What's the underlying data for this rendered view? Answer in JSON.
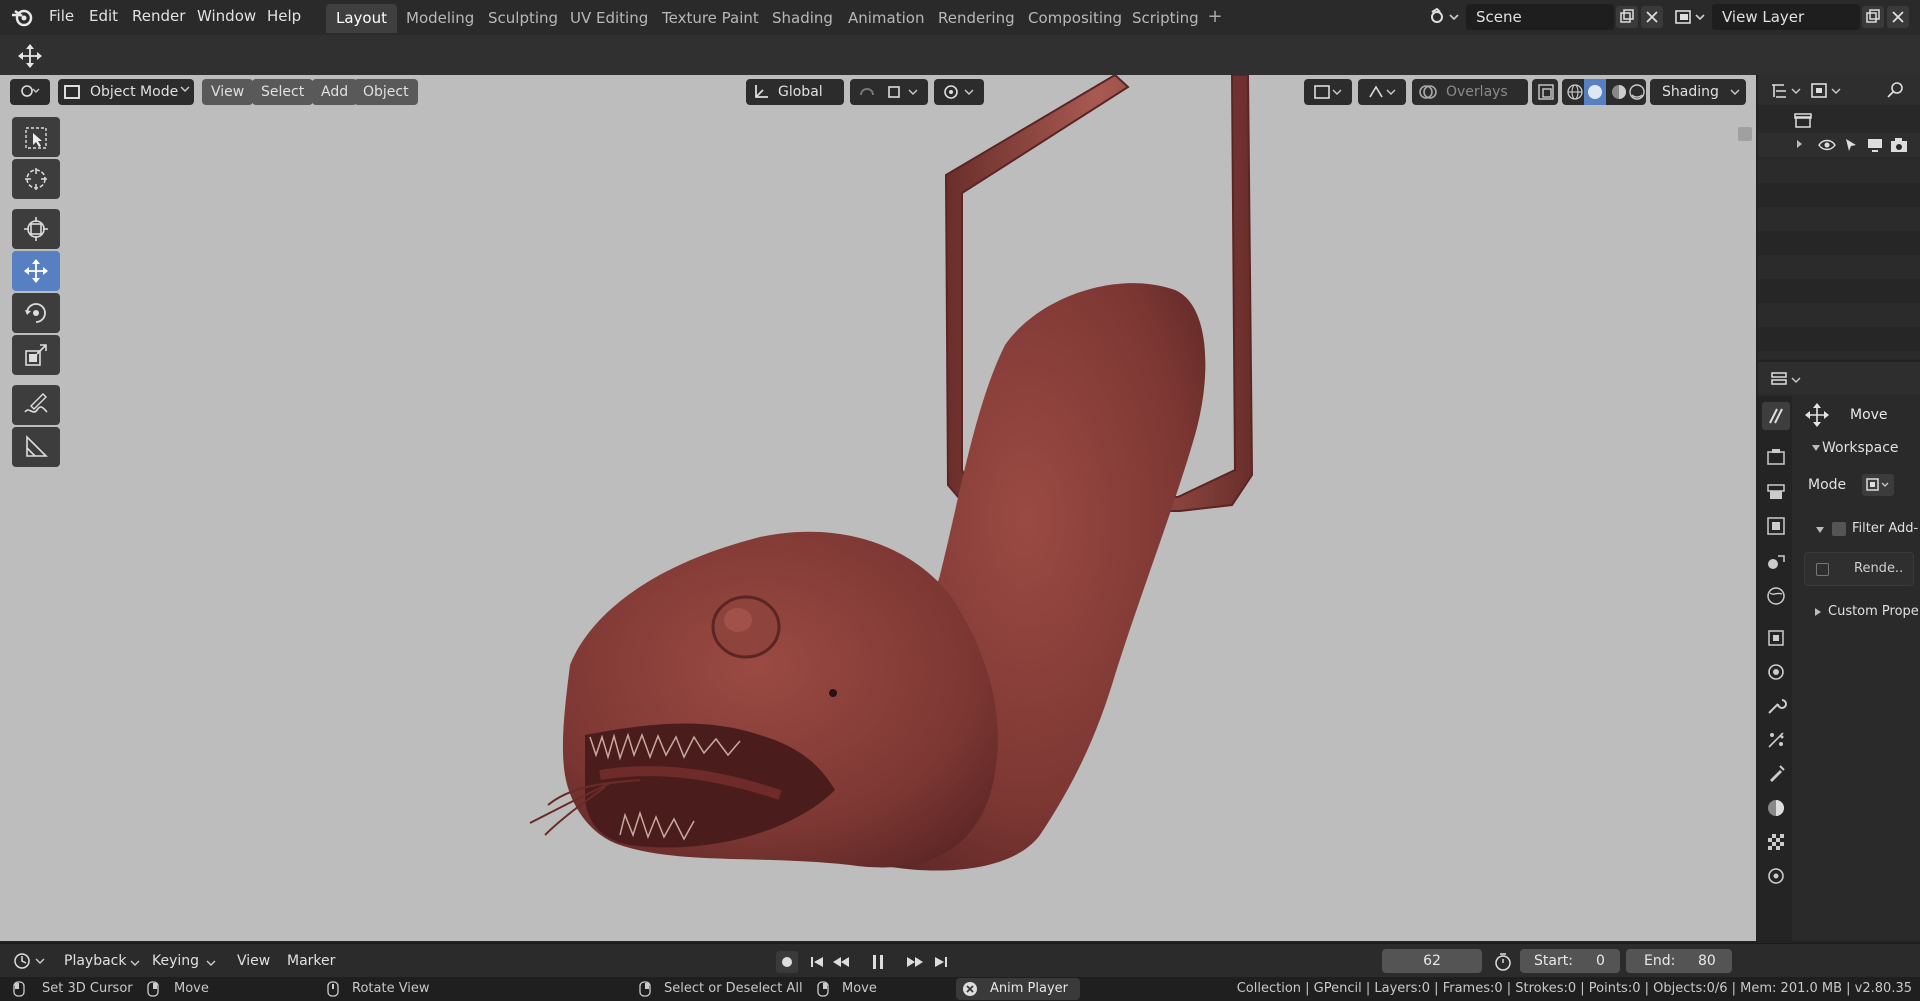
{
  "menu": {
    "items": [
      "File",
      "Edit",
      "Render",
      "Window",
      "Help"
    ]
  },
  "workspaces": {
    "tabs": [
      "Layout",
      "Modeling",
      "Sculpting",
      "UV Editing",
      "Texture Paint",
      "Shading",
      "Animation",
      "Rendering",
      "Compositing",
      "Scripting"
    ],
    "active": "Layout",
    "add_symbol": "+"
  },
  "scene": {
    "name": "Scene"
  },
  "view_layer": {
    "name": "View Layer"
  },
  "viewport_header": {
    "mode": "Object Mode",
    "menus": [
      "View",
      "Select",
      "Add",
      "Object"
    ],
    "orientation": "Global",
    "overlays_label": "Overlays",
    "shading_label": "Shading"
  },
  "tools": [
    "select-box",
    "cursor",
    "move-tool",
    "move",
    "rotate",
    "scale",
    "annotate",
    "measure"
  ],
  "active_tool": "move",
  "properties": {
    "tool_name": "Move",
    "workspace_panel": "Workspace",
    "mode_label": "Mode",
    "filter_addons_label": "Filter Add-",
    "render_label": "Rende..",
    "custom_props_label": "Custom Prope"
  },
  "timeline": {
    "menus": [
      "Playback",
      "Keying",
      "View",
      "Marker"
    ],
    "current_frame": "62",
    "start_label": "Start:",
    "start_value": "0",
    "end_label": "End:",
    "end_value": "80"
  },
  "status": {
    "set_cursor": "Set 3D Cursor",
    "move1": "Move",
    "rotate_view": "Rotate View",
    "select_all": "Select or Deselect All",
    "move2": "Move",
    "anim_player": "Anim Player",
    "stats": "Collection | GPencil | Layers:0 | Frames:0 | Strokes:0 | Points:0 | Objects:0/6 | Mem: 201.0 MB | v2.80.35"
  },
  "colors": {
    "viewport_bg": "#bdbdbd",
    "active_blue": "#5680c2",
    "creature": "#8c3f3a"
  }
}
